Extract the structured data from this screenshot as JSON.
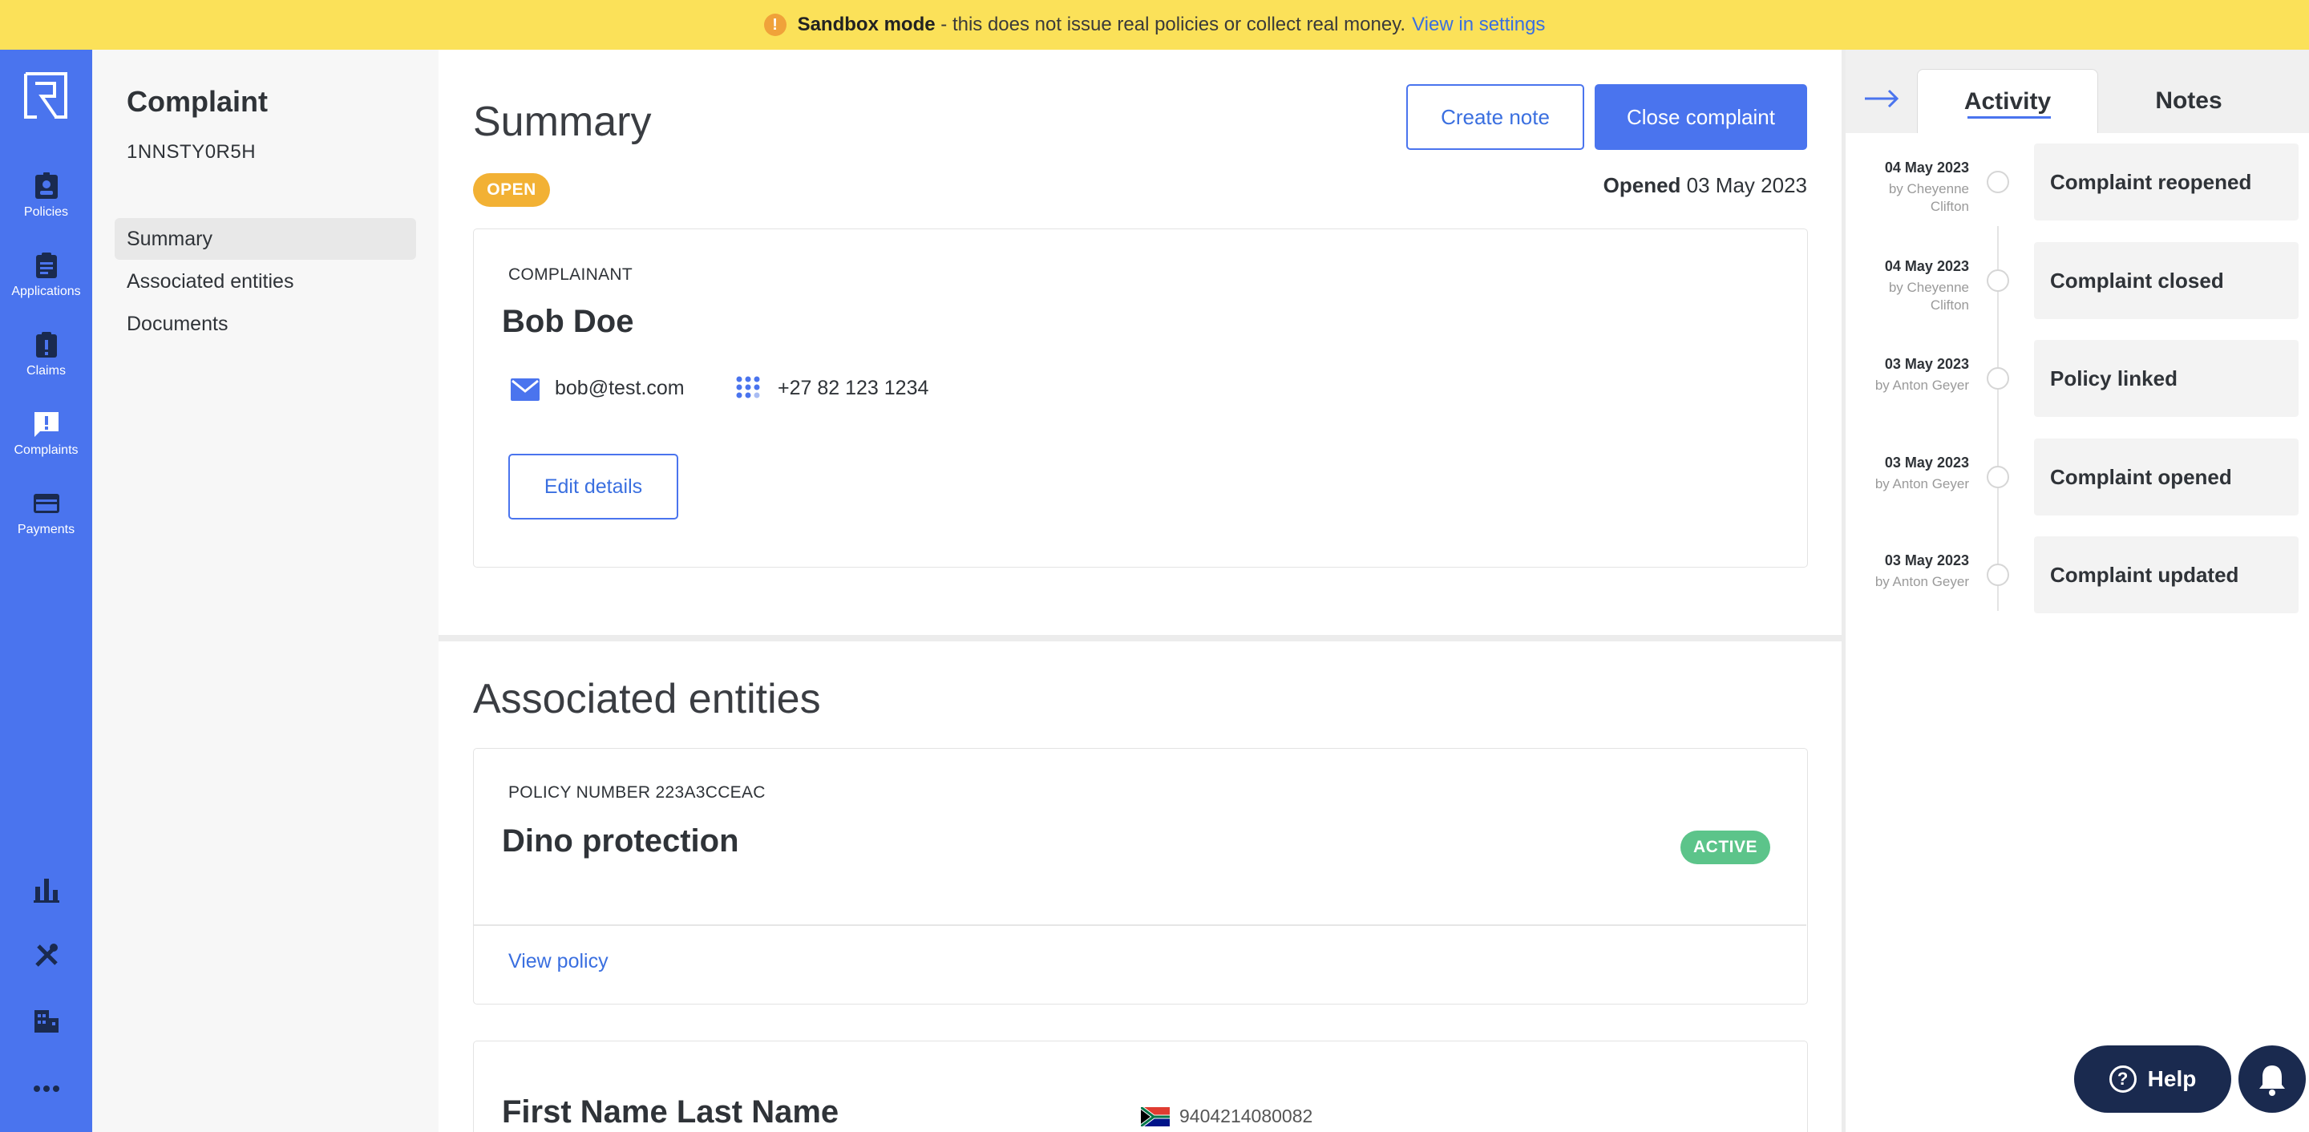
{
  "banner": {
    "bold": "Sandbox mode",
    "text": " - this does not issue real policies or collect real money.",
    "link": "View in settings"
  },
  "rail": {
    "items": [
      {
        "label": "Policies",
        "icon": "badge-icon"
      },
      {
        "label": "Applications",
        "icon": "clipboard-icon"
      },
      {
        "label": "Claims",
        "icon": "clipboard-alert-icon"
      },
      {
        "label": "Complaints",
        "icon": "message-alert-icon"
      },
      {
        "label": "Payments",
        "icon": "credit-card-icon"
      }
    ],
    "bottom_icons": [
      "bar-chart-icon",
      "tools-icon",
      "building-icon",
      "more-icon"
    ]
  },
  "subnav": {
    "title": "Complaint",
    "ref": "1NNSTY0R5H",
    "items": [
      "Summary",
      "Associated entities",
      "Documents"
    ]
  },
  "summary": {
    "title": "Summary",
    "create_note": "Create note",
    "close_complaint": "Close complaint",
    "status": "OPEN",
    "opened_label": "Opened",
    "opened_date": " 03 May 2023",
    "complainant_label": "COMPLAINANT",
    "name": "Bob Doe",
    "email": "bob@test.com",
    "phone": "+27 82 123 1234",
    "edit_details": "Edit details"
  },
  "associated": {
    "title": "Associated entities",
    "policy_label": "POLICY NUMBER 223A3CCEAC",
    "policy_name": "Dino protection",
    "policy_status": "ACTIVE",
    "view_policy": "View policy",
    "person_name": "First Name Last Name",
    "id_number": "9404214080082"
  },
  "activity": {
    "tabs": [
      "Activity",
      "Notes"
    ],
    "items": [
      {
        "date": "04 May 2023",
        "by": "by Cheyenne Clifton",
        "title": "Complaint reopened"
      },
      {
        "date": "04 May 2023",
        "by": "by Cheyenne Clifton",
        "title": "Complaint closed"
      },
      {
        "date": "03 May 2023",
        "by": "by Anton Geyer",
        "title": "Policy linked"
      },
      {
        "date": "03 May 2023",
        "by": "by Anton Geyer",
        "title": "Complaint opened"
      },
      {
        "date": "03 May 2023",
        "by": "by Anton Geyer",
        "title": "Complaint updated"
      }
    ]
  },
  "help": {
    "label": "Help"
  },
  "colors": {
    "accent": "#4a74ee",
    "banner": "#fbe159",
    "open": "#f2b134",
    "active": "#5cc48a"
  }
}
